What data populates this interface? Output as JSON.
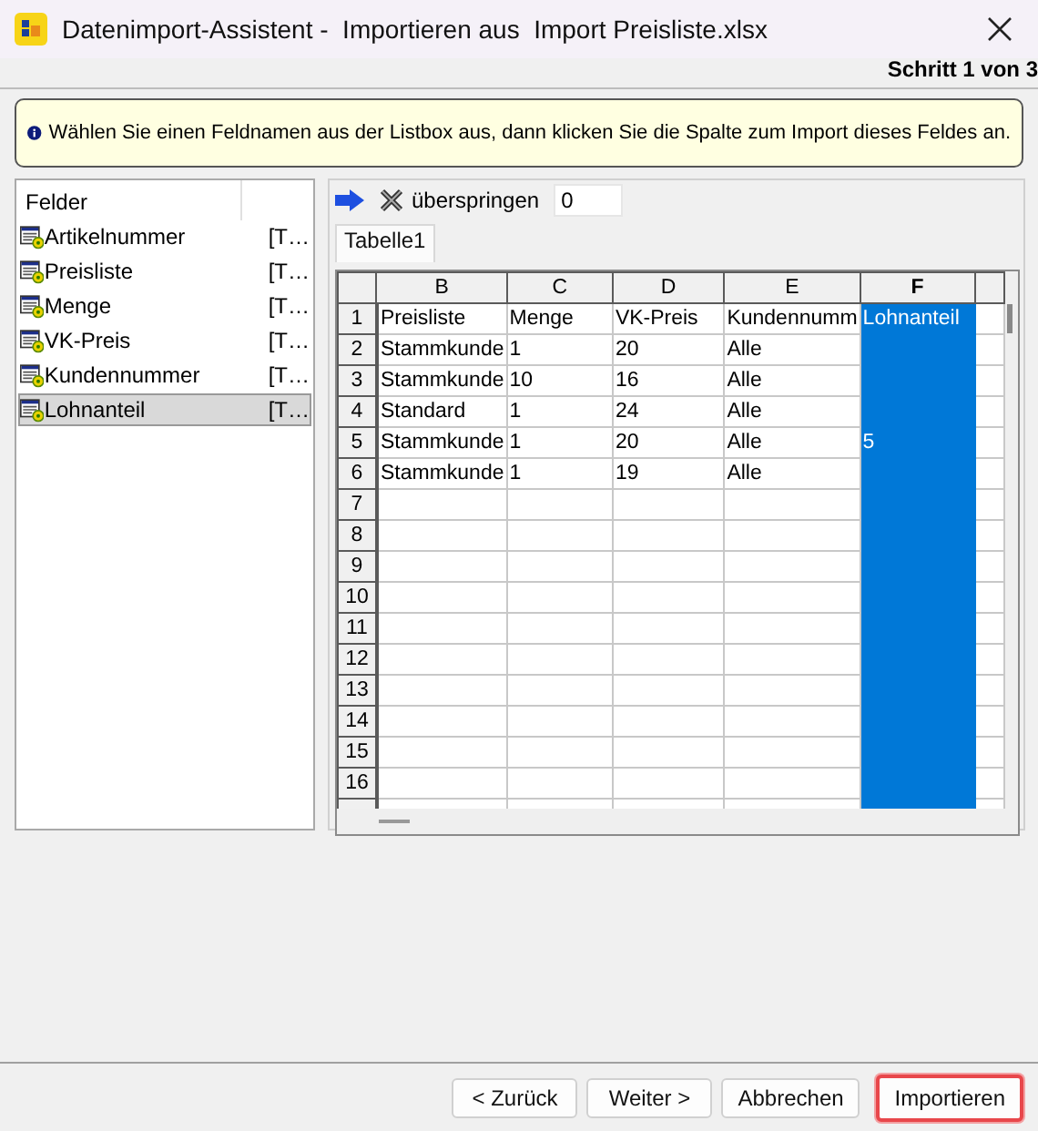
{
  "window": {
    "title": "Datenimport-Assistent -  Importieren aus  Import Preisliste.xlsx",
    "step": "Schritt 1 von 3"
  },
  "info": "Wählen Sie einen Feldnamen aus der Listbox aus, dann klicken Sie die Spalte zum Import dieses Feldes an.",
  "field_list": {
    "header": "Felder",
    "items": [
      {
        "name": "Artikelnummer",
        "type": "[T…",
        "selected": false
      },
      {
        "name": "Preisliste",
        "type": "[T…",
        "selected": false
      },
      {
        "name": "Menge",
        "type": "[T…",
        "selected": false
      },
      {
        "name": "VK-Preis",
        "type": "[T…",
        "selected": false
      },
      {
        "name": "Kundennummer",
        "type": "[T…",
        "selected": false
      },
      {
        "name": "Lohnanteil",
        "type": "[T…",
        "selected": true
      }
    ]
  },
  "toolbar": {
    "skip_label": "überspringen",
    "skip_value": "0"
  },
  "tabs": [
    {
      "label": "Tabelle1",
      "selected": true
    }
  ],
  "sheet": {
    "columns": [
      {
        "label": "B",
        "selected": false
      },
      {
        "label": "C",
        "selected": false
      },
      {
        "label": "D",
        "selected": false
      },
      {
        "label": "E",
        "selected": false
      },
      {
        "label": "F",
        "selected": true
      }
    ],
    "rows": [
      {
        "number": "1",
        "cells": [
          "Preisliste",
          "Menge",
          "VK-Preis",
          "Kundennumm",
          "Lohnanteil"
        ]
      },
      {
        "number": "2",
        "cells": [
          "Stammkunde",
          "1",
          "20",
          "Alle",
          ""
        ]
      },
      {
        "number": "3",
        "cells": [
          "Stammkunde",
          "10",
          "16",
          "Alle",
          ""
        ]
      },
      {
        "number": "4",
        "cells": [
          "Standard",
          "1",
          "24",
          "Alle",
          ""
        ]
      },
      {
        "number": "5",
        "cells": [
          "Stammkunde",
          "1",
          "20",
          "Alle",
          "5"
        ]
      },
      {
        "number": "6",
        "cells": [
          "Stammkunde",
          "1",
          "19",
          "Alle",
          ""
        ]
      },
      {
        "number": "7",
        "cells": [
          "",
          "",
          "",
          "",
          ""
        ]
      },
      {
        "number": "8",
        "cells": [
          "",
          "",
          "",
          "",
          ""
        ]
      },
      {
        "number": "9",
        "cells": [
          "",
          "",
          "",
          "",
          ""
        ]
      },
      {
        "number": "10",
        "cells": [
          "",
          "",
          "",
          "",
          ""
        ]
      },
      {
        "number": "11",
        "cells": [
          "",
          "",
          "",
          "",
          ""
        ]
      },
      {
        "number": "12",
        "cells": [
          "",
          "",
          "",
          "",
          ""
        ]
      },
      {
        "number": "13",
        "cells": [
          "",
          "",
          "",
          "",
          ""
        ]
      },
      {
        "number": "14",
        "cells": [
          "",
          "",
          "",
          "",
          ""
        ]
      },
      {
        "number": "15",
        "cells": [
          "",
          "",
          "",
          "",
          ""
        ]
      },
      {
        "number": "16",
        "cells": [
          "",
          "",
          "",
          "",
          ""
        ]
      }
    ]
  },
  "buttons": [
    {
      "label": "< Zurück",
      "highlighted": false
    },
    {
      "label": "Weiter >",
      "highlighted": false
    },
    {
      "label": "Abbrechen",
      "highlighted": false
    },
    {
      "label": "Importieren",
      "highlighted": true
    }
  ]
}
